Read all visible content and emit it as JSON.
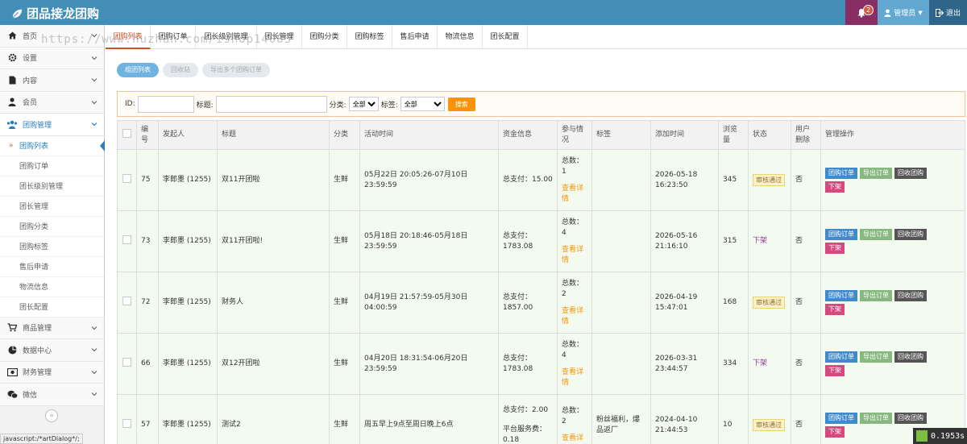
{
  "app": {
    "title": "团品接龙团购"
  },
  "topbar": {
    "badge": "2",
    "user": "管理员",
    "logout": "退出"
  },
  "sidebar": {
    "items": [
      {
        "label": "首页",
        "icon": "home-icon"
      },
      {
        "label": "设置",
        "icon": "gear-icon"
      },
      {
        "label": "内容",
        "icon": "file-icon"
      },
      {
        "label": "会员",
        "icon": "user-icon"
      },
      {
        "label": "团购管理",
        "icon": "users-icon"
      }
    ],
    "sub": [
      "团购列表",
      "团购订单",
      "团长级别管理",
      "团长管理",
      "团购分类",
      "团购标签",
      "售后申请",
      "物流信息",
      "团长配置"
    ],
    "items2": [
      {
        "label": "商品管理",
        "icon": "cart-icon"
      },
      {
        "label": "数据中心",
        "icon": "piechart-icon"
      },
      {
        "label": "财务管理",
        "icon": "money-icon"
      },
      {
        "label": "微信",
        "icon": "wechat-icon"
      }
    ],
    "collapse": "«",
    "status_link": "javascript:/*artDialog*/;"
  },
  "tabs": [
    "团购列表",
    "团购订单",
    "团长级别管理",
    "团长管理",
    "团购分类",
    "团购标签",
    "售后申请",
    "物流信息",
    "团长配置"
  ],
  "watermark": "https://www.huzhan.com/ishop14085",
  "subtabs": [
    "组团列表",
    "回收站",
    "导出多个团购订单"
  ],
  "filter": {
    "id_label": "ID:",
    "title_label": "标题:",
    "cat_label": "分类:",
    "cat_value": "全部",
    "tag_label": "标签:",
    "tag_value": "全部",
    "search": "搜索"
  },
  "table": {
    "headers": [
      "",
      "编号",
      "发起人",
      "标题",
      "分类",
      "活动时间",
      "资金信息",
      "参与情况",
      "标签",
      "添加时间",
      "浏览量",
      "状态",
      "用户删除",
      "管理操作"
    ],
    "rows": [
      {
        "id": "75",
        "initiator": "李郎墨 (1255)",
        "title": "双11开团啦",
        "cat": "生鲜",
        "time": "05月22日 20:05:26-07月10日 23:59:59",
        "money1": "总支付：15.00",
        "money2": "",
        "money3": "",
        "join1": "总数：",
        "join2": "1",
        "join_link": "查看详情",
        "tag": "",
        "added1": "2026-05-18",
        "added2": "16:23:50",
        "views": "345",
        "status": "审核通过",
        "status_type": "pass",
        "deleted": "否"
      },
      {
        "id": "73",
        "initiator": "李郎墨 (1255)",
        "title": "双11开团啦!",
        "cat": "生鲜",
        "time": "05月18日 20:18:46-05月18日 23:59:59",
        "money1": "总支付：",
        "money2": "1783.08",
        "money3": "",
        "join1": "总数：",
        "join2": "4",
        "join_link": "查看详情",
        "tag": "",
        "added1": "2026-05-16",
        "added2": "21:16:10",
        "views": "315",
        "status": "下架",
        "status_type": "down",
        "deleted": "否"
      },
      {
        "id": "72",
        "initiator": "李郎墨 (1255)",
        "title": "财务人",
        "cat": "生鲜",
        "time": "04月19日 21:57:59-05月30日 04:00:59",
        "money1": "总支付：",
        "money2": "1857.00",
        "money3": "",
        "join1": "总数：",
        "join2": "2",
        "join_link": "查看详情",
        "tag": "",
        "added1": "2026-04-19",
        "added2": "15:47:01",
        "views": "168",
        "status": "审核通过",
        "status_type": "pass",
        "deleted": "否"
      },
      {
        "id": "66",
        "initiator": "李郎墨 (1255)",
        "title": "双12开团啦",
        "cat": "生鲜",
        "time": "04月20日 18:31:54-06月20日 23:59:59",
        "money1": "总支付：",
        "money2": "1783.08",
        "money3": "",
        "join1": "总数：",
        "join2": "4",
        "join_link": "查看详情",
        "tag": "",
        "added1": "2026-03-31",
        "added2": "23:44:57",
        "views": "334",
        "status": "下架",
        "status_type": "down",
        "deleted": "否"
      },
      {
        "id": "57",
        "initiator": "李郎墨 (1255)",
        "title": "测试2",
        "cat": "生鲜",
        "time": "周五早上9点至周日晚上6点",
        "money1": "总支付：2.00",
        "money2": "平台服务费：",
        "money3": "0.18",
        "join1": "总数：",
        "join2": "2",
        "join_link": "查看详",
        "tag": "粉丝福利，爆品返厂",
        "added1": "2024-04-10",
        "added2": "21:44:53",
        "views": "10",
        "status": "审核通过",
        "status_type": "pass",
        "deleted": "否"
      }
    ],
    "ops": [
      "团购订单",
      "导出订单",
      "回收团购",
      "下架"
    ]
  },
  "timer": "0.1953s"
}
